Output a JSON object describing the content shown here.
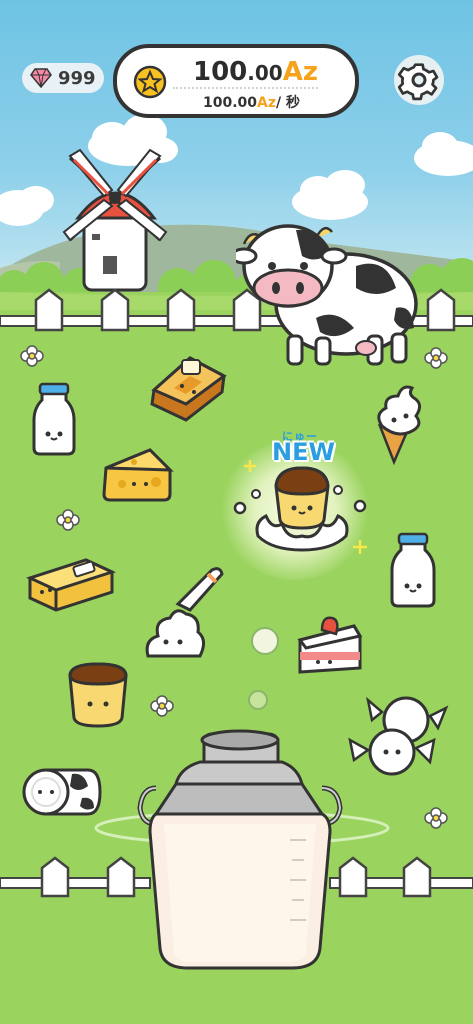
{
  "hud": {
    "gems": "999",
    "currency_int": "100",
    "currency_dec": ".00",
    "currency_unit": "Az",
    "rate_value": "100.00",
    "rate_unit": "Az",
    "rate_suffix": "/ 秒"
  },
  "new_badge": {
    "furigana": "にゅー",
    "label": "NEW"
  },
  "icons": [
    "gem-icon",
    "star-coin-icon",
    "gear-icon"
  ],
  "colors": {
    "accent_orange": "#f6a21a",
    "new_blue": "#2a9ee0",
    "grass": "#9ad35e",
    "sky": "#6ec3e4"
  }
}
